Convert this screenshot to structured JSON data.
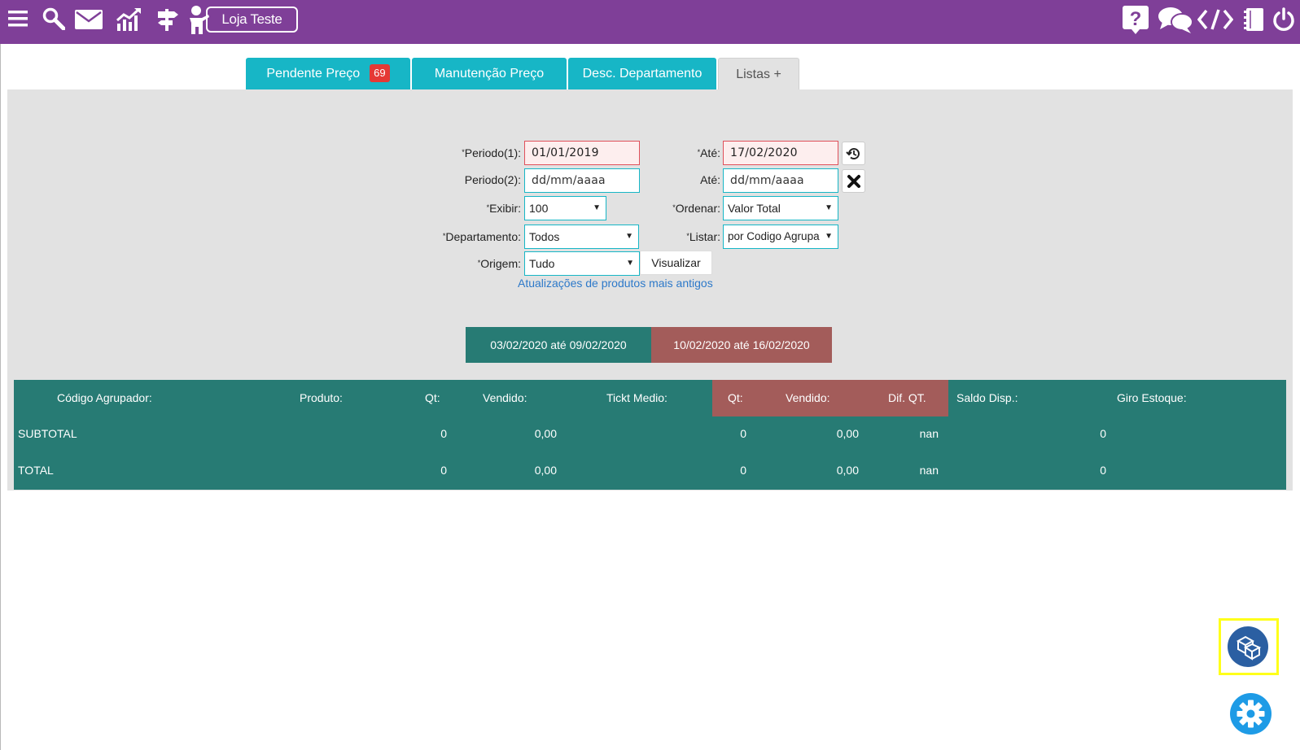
{
  "topbar": {
    "store_label": "Loja Teste",
    "icons_left": [
      "menu-icon",
      "search-icon",
      "mail-icon",
      "chart-icon",
      "signpost-icon",
      "user-presenter-icon"
    ],
    "icons_right": [
      "help-icon",
      "chat-icon",
      "code-icon",
      "notebook-icon",
      "power-icon"
    ],
    "bg_color": "#7f3f98"
  },
  "tabs": [
    {
      "label": "Pendente Preço",
      "badge": "69"
    },
    {
      "label": "Manutenção Preço"
    },
    {
      "label": "Desc. Departamento"
    },
    {
      "label": "Listas +"
    }
  ],
  "form": {
    "periodo1": {
      "label": "Periodo(1):",
      "value": "01/01/2019"
    },
    "ate1": {
      "label": "Até:",
      "value": "17/02/2020"
    },
    "periodo2": {
      "label": "Periodo(2):",
      "placeholder": "dd/mm/aaaa"
    },
    "ate2": {
      "label": "Até:",
      "placeholder": "dd/mm/aaaa"
    },
    "exibir": {
      "label": "Exibir:",
      "value": "100"
    },
    "ordenar": {
      "label": "Ordenar:",
      "value": "Valor Total"
    },
    "departamento": {
      "label": "Departamento:",
      "value": "Todos"
    },
    "listar": {
      "label": "Listar:",
      "value": "por Codigo Agrupa"
    },
    "origem": {
      "label": "Origem:",
      "value": "Tudo"
    },
    "visualizar_label": "Visualizar",
    "link_text": "Atualizações de produtos mais antigos",
    "required_mark": "*"
  },
  "periods": {
    "p1": "03/02/2020 até 09/02/2020",
    "p2": "10/02/2020 até 16/02/2020"
  },
  "table": {
    "headers": {
      "codigo": "Código Agrupador:",
      "produto": "Produto:",
      "qt1": "Qt:",
      "vendido1": "Vendido:",
      "ticket": "Tickt Medio:",
      "qt2": "Qt:",
      "vendido2": "Vendido:",
      "dif": "Dif. QT.",
      "saldo": "Saldo Disp.:",
      "giro": "Giro Estoque:"
    },
    "rows": [
      {
        "label": "SUBTOTAL",
        "qt1": "0",
        "vendido1": "0,00",
        "qt2": "0",
        "vendido2": "0,00",
        "dif": "nan",
        "saldo": "0"
      },
      {
        "label": "TOTAL",
        "qt1": "0",
        "vendido1": "0,00",
        "qt2": "0",
        "vendido2": "0,00",
        "dif": "nan",
        "saldo": "0"
      }
    ],
    "colors": {
      "teal": "#277b74",
      "red": "#a35c5a"
    }
  },
  "floating": {
    "box_icon": "boxes-icon",
    "gear_icon": "gear-icon"
  }
}
